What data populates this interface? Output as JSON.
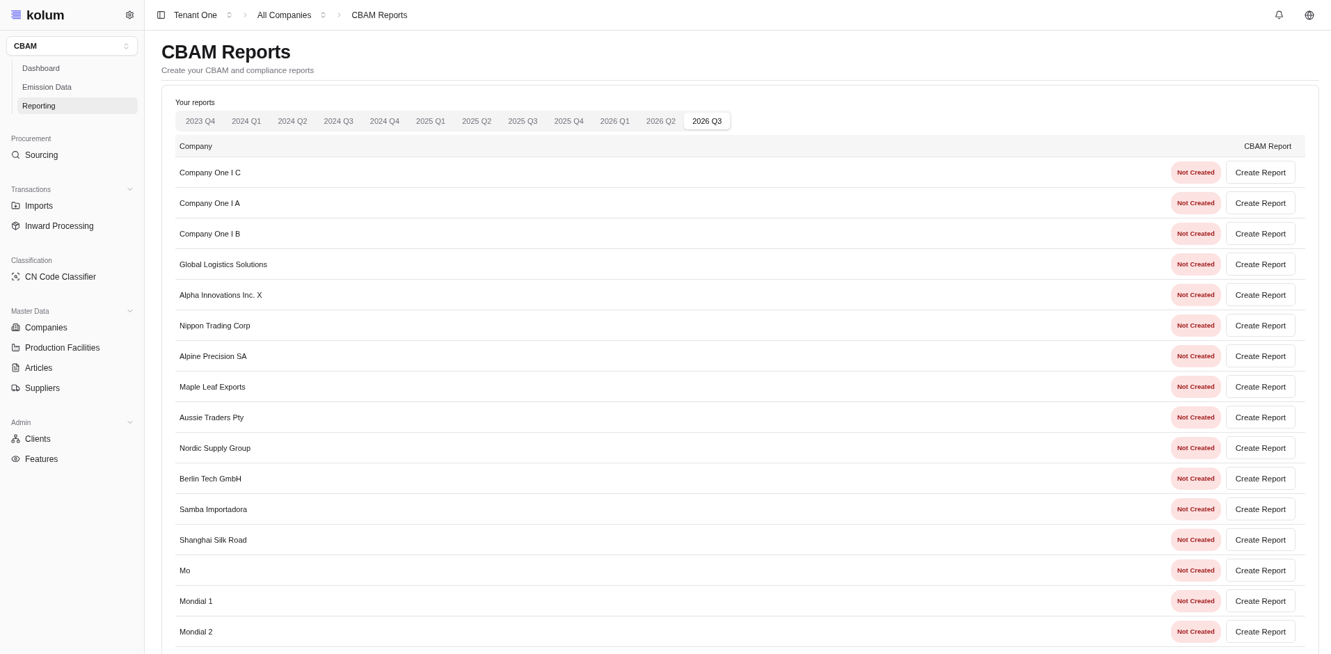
{
  "sidebar": {
    "brand": "kolum",
    "module_select": {
      "value": "CBAM"
    },
    "module_items": [
      {
        "label": "Dashboard",
        "selected": false
      },
      {
        "label": "Emission Data",
        "selected": false
      },
      {
        "label": "Reporting",
        "selected": true
      }
    ],
    "sections": [
      {
        "title": "Procurement",
        "items": [
          {
            "label": "Sourcing"
          }
        ]
      },
      {
        "title": "Transactions",
        "expanded": true,
        "items": [
          {
            "label": "Imports"
          },
          {
            "label": "Inward Processing"
          }
        ]
      },
      {
        "title": "Classification",
        "items": [
          {
            "label": "CN Code Classifier"
          }
        ]
      },
      {
        "title": "Master Data",
        "expanded": true,
        "items": [
          {
            "label": "Companies"
          },
          {
            "label": "Production Facilities"
          },
          {
            "label": "Articles"
          },
          {
            "label": "Suppliers"
          }
        ]
      },
      {
        "title": "Admin",
        "expanded": true,
        "items": [
          {
            "label": "Clients"
          },
          {
            "label": "Features"
          }
        ]
      }
    ]
  },
  "breadcrumb": [
    {
      "label": "Tenant One",
      "switcher": true
    },
    {
      "label": "All Companies",
      "switcher": true
    },
    {
      "label": "CBAM Reports",
      "switcher": false
    }
  ],
  "page": {
    "title": "CBAM Reports",
    "subtitle": "Create your CBAM and compliance reports"
  },
  "reports": {
    "label": "Your reports",
    "tabs": [
      {
        "label": "2023 Q4",
        "selected": false
      },
      {
        "label": "2024 Q1",
        "selected": false
      },
      {
        "label": "2024 Q2",
        "selected": false
      },
      {
        "label": "2024 Q3",
        "selected": false
      },
      {
        "label": "2024 Q4",
        "selected": false
      },
      {
        "label": "2025 Q1",
        "selected": false
      },
      {
        "label": "2025 Q2",
        "selected": false
      },
      {
        "label": "2025 Q3",
        "selected": false
      },
      {
        "label": "2025 Q4",
        "selected": false
      },
      {
        "label": "2026 Q1",
        "selected": false
      },
      {
        "label": "2026 Q2",
        "selected": false
      },
      {
        "label": "2026 Q3",
        "selected": true
      }
    ],
    "columns": [
      "Company",
      "CBAM Report"
    ],
    "rows": [
      {
        "company": "Company One I C",
        "status": "Not Created",
        "action": "Create Report"
      },
      {
        "company": "Company One I A",
        "status": "Not Created",
        "action": "Create Report"
      },
      {
        "company": "Company One I B",
        "status": "Not Created",
        "action": "Create Report"
      },
      {
        "company": "Global Logistics Solutions",
        "status": "Not Created",
        "action": "Create Report"
      },
      {
        "company": "Alpha Innovations Inc. X",
        "status": "Not Created",
        "action": "Create Report"
      },
      {
        "company": "Nippon Trading Corp",
        "status": "Not Created",
        "action": "Create Report"
      },
      {
        "company": "Alpine Precision SA",
        "status": "Not Created",
        "action": "Create Report"
      },
      {
        "company": "Maple Leaf Exports",
        "status": "Not Created",
        "action": "Create Report"
      },
      {
        "company": "Aussie Traders Pty",
        "status": "Not Created",
        "action": "Create Report"
      },
      {
        "company": "Nordic Supply Group",
        "status": "Not Created",
        "action": "Create Report"
      },
      {
        "company": "Berlin Tech GmbH",
        "status": "Not Created",
        "action": "Create Report"
      },
      {
        "company": "Samba Importadora",
        "status": "Not Created",
        "action": "Create Report"
      },
      {
        "company": "Shanghai Silk Road",
        "status": "Not Created",
        "action": "Create Report"
      },
      {
        "company": "Mo",
        "status": "Not Created",
        "action": "Create Report"
      },
      {
        "company": "Mondial 1",
        "status": "Not Created",
        "action": "Create Report"
      },
      {
        "company": "Mondial 2",
        "status": "Not Created",
        "action": "Create Report"
      }
    ]
  }
}
